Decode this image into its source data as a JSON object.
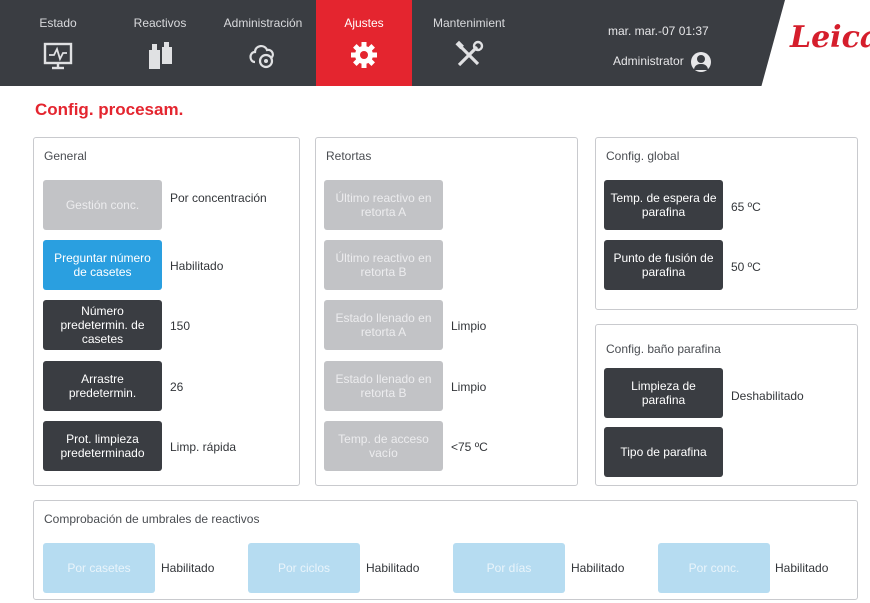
{
  "nav": {
    "tabs": [
      {
        "label": "Estado",
        "icon": "monitor-status-icon"
      },
      {
        "label": "Reactivos",
        "icon": "reagent-bottles-icon"
      },
      {
        "label": "Administración",
        "icon": "administration-icon"
      },
      {
        "label": "Ajustes",
        "icon": "gear-icon"
      },
      {
        "label": "Mantenimient",
        "icon": "tools-icon"
      }
    ],
    "active_tab": "Ajustes",
    "datetime": "mar. mar.-07 01:37",
    "user": "Administrator",
    "logo": "Leica",
    "colors": {
      "bar": "#3a3d42",
      "active": "#e4252f",
      "logo": "#d51e2c"
    }
  },
  "page": {
    "title": "Config. procesam."
  },
  "general": {
    "title": "General",
    "rows": [
      {
        "button": "Gestión conc.",
        "value": "Por concentración",
        "state": "disabled"
      },
      {
        "button": "Preguntar número de casetes",
        "value": "Habilitado",
        "state": "selected"
      },
      {
        "button": "Número predetermin. de casetes",
        "value": "150",
        "state": "enabled"
      },
      {
        "button": "Arrastre predetermin.",
        "value": "26",
        "state": "enabled"
      },
      {
        "button": "Prot. limpieza predeterminado",
        "value": "Limp. rápida",
        "state": "enabled"
      }
    ]
  },
  "retortas": {
    "title": "Retortas",
    "rows": [
      {
        "button": "Último reactivo en retorta A",
        "value": ""
      },
      {
        "button": "Último reactivo en retorta B",
        "value": ""
      },
      {
        "button": "Estado llenado en retorta A",
        "value": "Limpio"
      },
      {
        "button": "Estado llenado en retorta B",
        "value": "Limpio"
      },
      {
        "button": "Temp. de acceso vacío",
        "value": "<75 ºC"
      }
    ]
  },
  "global": {
    "title": "Config. global",
    "rows": [
      {
        "button": "Temp. de espera de parafina",
        "value": "65 ºC"
      },
      {
        "button": "Punto de fusión de parafina",
        "value": "50 ºC"
      }
    ]
  },
  "bath": {
    "title": "Config. baño parafina",
    "rows": [
      {
        "button": "Limpieza de parafina",
        "value": "Deshabilitado"
      },
      {
        "button": "Tipo de parafina",
        "value": ""
      }
    ]
  },
  "thresholds": {
    "title": "Comprobación de umbrales de reactivos",
    "items": [
      {
        "button": "Por casetes",
        "value": "Habilitado"
      },
      {
        "button": "Por ciclos",
        "value": "Habilitado"
      },
      {
        "button": "Por días",
        "value": "Habilitado"
      },
      {
        "button": "Por conc.",
        "value": "Habilitado"
      }
    ]
  }
}
